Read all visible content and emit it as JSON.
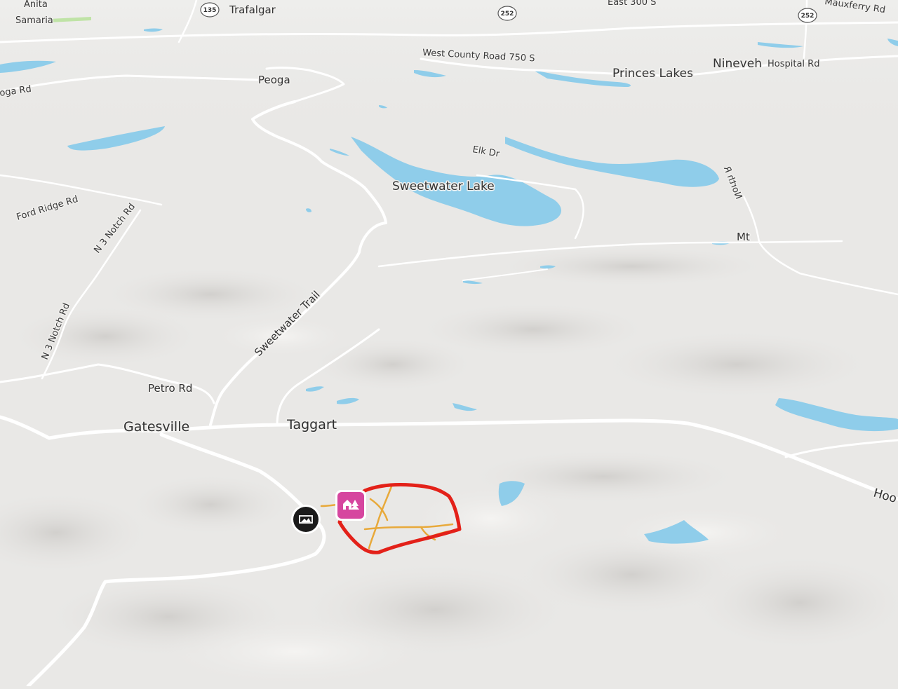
{
  "map": {
    "places": {
      "anita": "Anita",
      "samaria": "Samaria",
      "trafalgar": "Trafalgar",
      "peoga": "Peoga",
      "princes_lakes": "Princes Lakes",
      "nineveh": "Nineveh",
      "gatesville": "Gatesville",
      "taggart": "Taggart",
      "mt": "Mt"
    },
    "roads": {
      "east_300_s": "East 300 S",
      "mauxferry_rd": "Mauxferry Rd",
      "west_county_road_750_s": "West County Road 750 S",
      "hospital_rd": "Hospital Rd",
      "peoga_rd": "oga Rd",
      "elk_dr": "Elk Dr",
      "ford_ridge_rd": "Ford Ridge Rd",
      "n_notch_rd_upper": "N 3 Notch Rd",
      "n_notch_rd_lower": "N 3 Notch Rd",
      "sweetwater_trail": "Sweetwater Trail",
      "petro_rd": "Petro Rd",
      "north_rd": "North R",
      "hoo_rd": "Hoo"
    },
    "water": {
      "sweetwater_lake": "Sweetwater Lake"
    },
    "route_shields": [
      "135",
      "252",
      "252"
    ],
    "markers": {
      "viewpoint_icon": "photo-viewpoint-icon",
      "property_icon": "cabin-property-icon"
    },
    "colors": {
      "land": "#e9e8e6",
      "water": "#8fcdea",
      "road": "#ffffff",
      "boundary": "#e32119",
      "trail": "#e8a93a",
      "property_marker": "#d6469f",
      "viewpoint_marker": "#1a1a1a"
    }
  }
}
